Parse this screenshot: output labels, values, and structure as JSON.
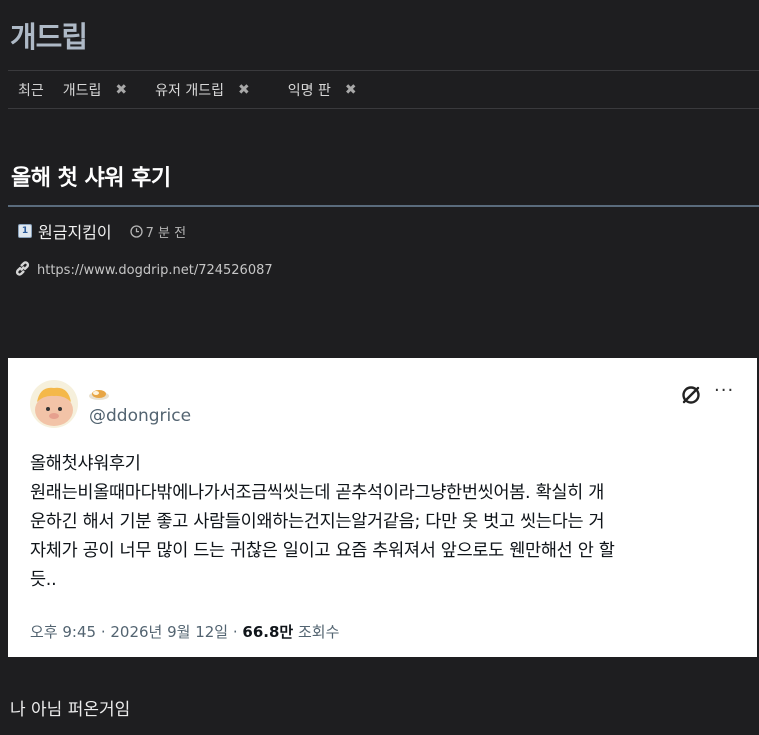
{
  "site": {
    "title": "개드립"
  },
  "tabs": {
    "recent_label": "최근",
    "items": [
      {
        "label": "개드립",
        "close": "✖"
      },
      {
        "label": "유저 개드립",
        "close": "✖"
      },
      {
        "label": "익명 판",
        "close": "✖"
      }
    ]
  },
  "post": {
    "title": "올해 첫 샤워 후기",
    "author": "원금지킴이",
    "level": "1",
    "time": "7 분 전",
    "link": "https://www.dogdrip.net/724526087",
    "caption": "나 아님 퍼온거임"
  },
  "tweet": {
    "badge": "🍛",
    "handle": "@ddongrice",
    "more": "···",
    "lines": [
      "올해첫샤워후기",
      "원래는비올때마다밖에나가서조금씩씻는데 곧추석이라그냥한번씻어봄. 확실히 개",
      "운하긴 해서 기분 좋고 사람들이왜하는건지는알거같음; 다만 옷 벗고 씻는다는 거",
      "자체가 공이 너무 많이 드는 귀찮은 일이고 요즘 추워져서 앞으로도 웬만해선 안 할",
      "듯.."
    ],
    "footer_time": "오후 9:45 · 2026년 9월 12일 · ",
    "views": "66.8만",
    "views_label": " 조회수"
  }
}
